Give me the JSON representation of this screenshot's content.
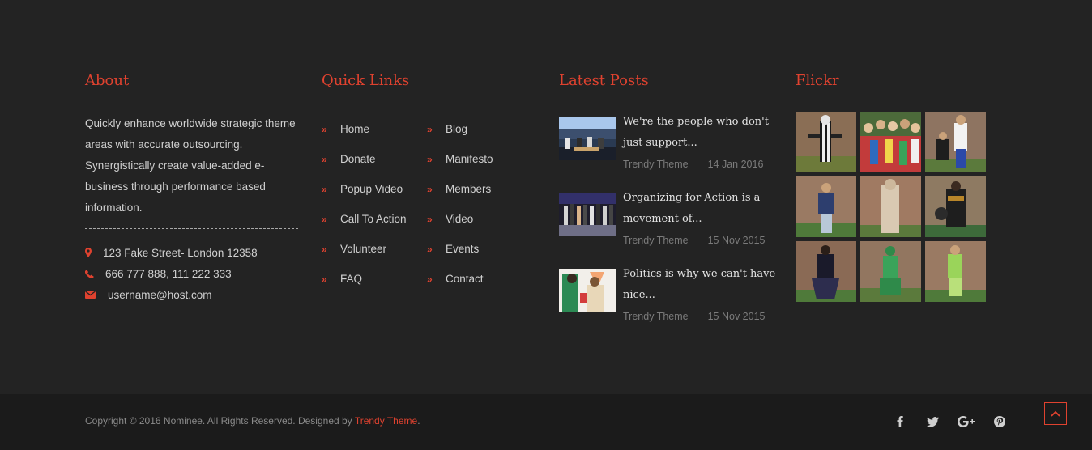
{
  "about": {
    "title": "About",
    "text": "Quickly enhance worldwide strategic theme areas with accurate outsourcing. Synergistically create value-added e-business through performance based information.",
    "address": "123 Fake Street- London 12358",
    "phone": "666 777 888, 111 222 333",
    "email": "username@host.com"
  },
  "quick_links": {
    "title": "Quick Links",
    "left": [
      "Home",
      "Donate",
      "Popup Video",
      "Call To Action",
      "Volunteer",
      "FAQ"
    ],
    "right": [
      "Blog",
      "Manifesto",
      "Members",
      "Video",
      "Events",
      "Contact"
    ]
  },
  "latest_posts": {
    "title": "Latest Posts",
    "items": [
      {
        "title_line1": "We're the people who don't",
        "title_line2": "just support...",
        "author": "Trendy Theme",
        "date": "14 Jan 2016"
      },
      {
        "title_line1": "Organizing for Action is a",
        "title_line2": "movement of...",
        "author": "Trendy Theme",
        "date": "15 Nov 2015"
      },
      {
        "title_line1": "Politics is why we can't have",
        "title_line2": "nice...",
        "author": "Trendy Theme",
        "date": "15 Nov 2015"
      }
    ]
  },
  "flickr": {
    "title": "Flickr",
    "count": 9
  },
  "footer": {
    "copyright": "Copyright © 2016 Nominee. All Rights Reserved. Designed by",
    "brand": "Trendy Theme",
    "period": ".",
    "social": [
      "facebook-icon",
      "twitter-icon",
      "google-plus-icon",
      "pinterest-icon"
    ]
  },
  "colors": {
    "accent": "#e0422f",
    "bg": "#232323",
    "bottom_bg": "#1b1b1b"
  }
}
